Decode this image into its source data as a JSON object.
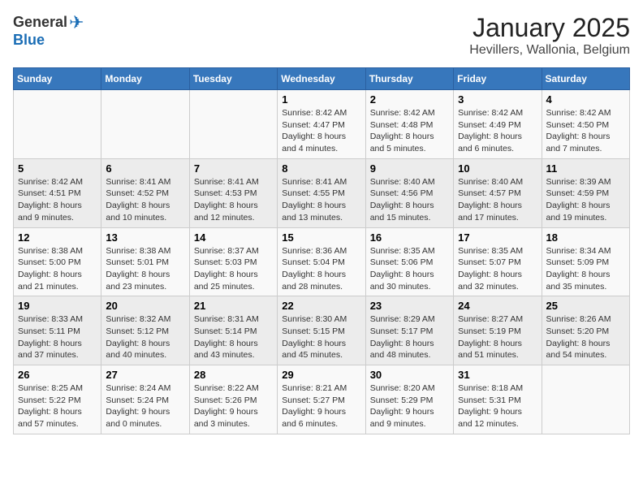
{
  "logo": {
    "general": "General",
    "blue": "Blue"
  },
  "title": "January 2025",
  "location": "Hevillers, Wallonia, Belgium",
  "days_of_week": [
    "Sunday",
    "Monday",
    "Tuesday",
    "Wednesday",
    "Thursday",
    "Friday",
    "Saturday"
  ],
  "weeks": [
    [
      {
        "day": "",
        "info": ""
      },
      {
        "day": "",
        "info": ""
      },
      {
        "day": "",
        "info": ""
      },
      {
        "day": "1",
        "info": "Sunrise: 8:42 AM\nSunset: 4:47 PM\nDaylight: 8 hours and 4 minutes."
      },
      {
        "day": "2",
        "info": "Sunrise: 8:42 AM\nSunset: 4:48 PM\nDaylight: 8 hours and 5 minutes."
      },
      {
        "day": "3",
        "info": "Sunrise: 8:42 AM\nSunset: 4:49 PM\nDaylight: 8 hours and 6 minutes."
      },
      {
        "day": "4",
        "info": "Sunrise: 8:42 AM\nSunset: 4:50 PM\nDaylight: 8 hours and 7 minutes."
      }
    ],
    [
      {
        "day": "5",
        "info": "Sunrise: 8:42 AM\nSunset: 4:51 PM\nDaylight: 8 hours and 9 minutes."
      },
      {
        "day": "6",
        "info": "Sunrise: 8:41 AM\nSunset: 4:52 PM\nDaylight: 8 hours and 10 minutes."
      },
      {
        "day": "7",
        "info": "Sunrise: 8:41 AM\nSunset: 4:53 PM\nDaylight: 8 hours and 12 minutes."
      },
      {
        "day": "8",
        "info": "Sunrise: 8:41 AM\nSunset: 4:55 PM\nDaylight: 8 hours and 13 minutes."
      },
      {
        "day": "9",
        "info": "Sunrise: 8:40 AM\nSunset: 4:56 PM\nDaylight: 8 hours and 15 minutes."
      },
      {
        "day": "10",
        "info": "Sunrise: 8:40 AM\nSunset: 4:57 PM\nDaylight: 8 hours and 17 minutes."
      },
      {
        "day": "11",
        "info": "Sunrise: 8:39 AM\nSunset: 4:59 PM\nDaylight: 8 hours and 19 minutes."
      }
    ],
    [
      {
        "day": "12",
        "info": "Sunrise: 8:38 AM\nSunset: 5:00 PM\nDaylight: 8 hours and 21 minutes."
      },
      {
        "day": "13",
        "info": "Sunrise: 8:38 AM\nSunset: 5:01 PM\nDaylight: 8 hours and 23 minutes."
      },
      {
        "day": "14",
        "info": "Sunrise: 8:37 AM\nSunset: 5:03 PM\nDaylight: 8 hours and 25 minutes."
      },
      {
        "day": "15",
        "info": "Sunrise: 8:36 AM\nSunset: 5:04 PM\nDaylight: 8 hours and 28 minutes."
      },
      {
        "day": "16",
        "info": "Sunrise: 8:35 AM\nSunset: 5:06 PM\nDaylight: 8 hours and 30 minutes."
      },
      {
        "day": "17",
        "info": "Sunrise: 8:35 AM\nSunset: 5:07 PM\nDaylight: 8 hours and 32 minutes."
      },
      {
        "day": "18",
        "info": "Sunrise: 8:34 AM\nSunset: 5:09 PM\nDaylight: 8 hours and 35 minutes."
      }
    ],
    [
      {
        "day": "19",
        "info": "Sunrise: 8:33 AM\nSunset: 5:11 PM\nDaylight: 8 hours and 37 minutes."
      },
      {
        "day": "20",
        "info": "Sunrise: 8:32 AM\nSunset: 5:12 PM\nDaylight: 8 hours and 40 minutes."
      },
      {
        "day": "21",
        "info": "Sunrise: 8:31 AM\nSunset: 5:14 PM\nDaylight: 8 hours and 43 minutes."
      },
      {
        "day": "22",
        "info": "Sunrise: 8:30 AM\nSunset: 5:15 PM\nDaylight: 8 hours and 45 minutes."
      },
      {
        "day": "23",
        "info": "Sunrise: 8:29 AM\nSunset: 5:17 PM\nDaylight: 8 hours and 48 minutes."
      },
      {
        "day": "24",
        "info": "Sunrise: 8:27 AM\nSunset: 5:19 PM\nDaylight: 8 hours and 51 minutes."
      },
      {
        "day": "25",
        "info": "Sunrise: 8:26 AM\nSunset: 5:20 PM\nDaylight: 8 hours and 54 minutes."
      }
    ],
    [
      {
        "day": "26",
        "info": "Sunrise: 8:25 AM\nSunset: 5:22 PM\nDaylight: 8 hours and 57 minutes."
      },
      {
        "day": "27",
        "info": "Sunrise: 8:24 AM\nSunset: 5:24 PM\nDaylight: 9 hours and 0 minutes."
      },
      {
        "day": "28",
        "info": "Sunrise: 8:22 AM\nSunset: 5:26 PM\nDaylight: 9 hours and 3 minutes."
      },
      {
        "day": "29",
        "info": "Sunrise: 8:21 AM\nSunset: 5:27 PM\nDaylight: 9 hours and 6 minutes."
      },
      {
        "day": "30",
        "info": "Sunrise: 8:20 AM\nSunset: 5:29 PM\nDaylight: 9 hours and 9 minutes."
      },
      {
        "day": "31",
        "info": "Sunrise: 8:18 AM\nSunset: 5:31 PM\nDaylight: 9 hours and 12 minutes."
      },
      {
        "day": "",
        "info": ""
      }
    ]
  ]
}
